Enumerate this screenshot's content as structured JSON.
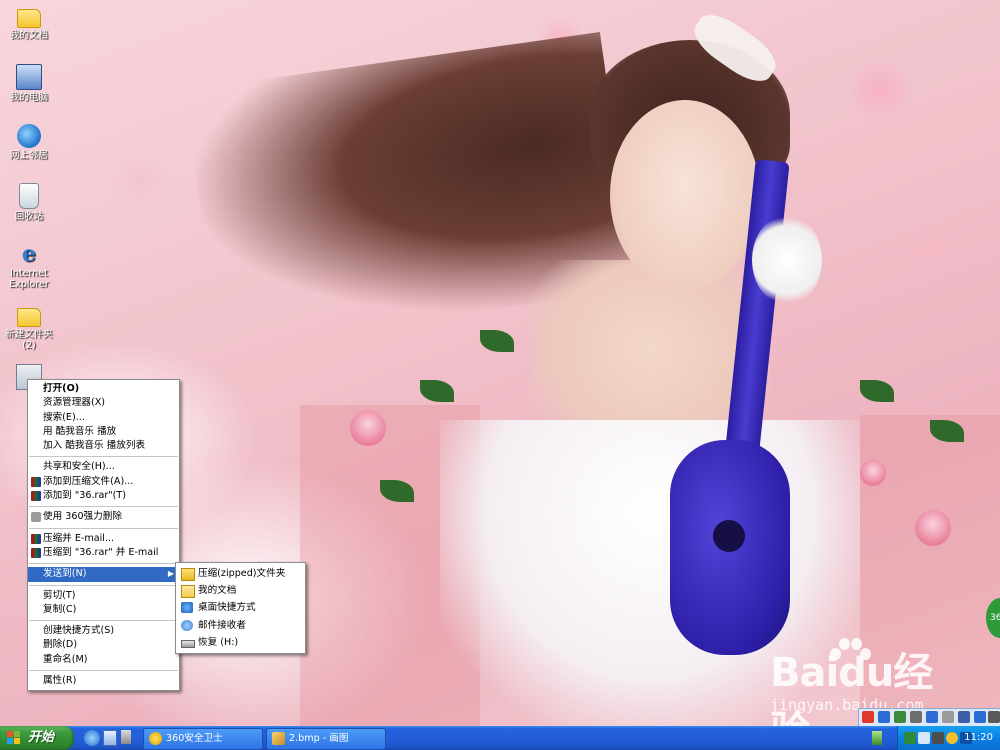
{
  "desktop_icons": [
    {
      "label": "我的文档",
      "icon": "my-documents-icon"
    },
    {
      "label": "我的电脑",
      "icon": "my-computer-icon"
    },
    {
      "label": "网上邻居",
      "icon": "network-places-icon"
    },
    {
      "label": "回收站",
      "icon": "recycle-bin-icon"
    },
    {
      "label": "Internet Explorer",
      "icon": "internet-explorer-icon"
    },
    {
      "label": "新建文件夹 (2)",
      "icon": "folder-icon"
    },
    {
      "label": "",
      "icon": "file-icon"
    }
  ],
  "context_menu": {
    "items": [
      {
        "label": "打开(O)",
        "bold": true
      },
      {
        "label": "资源管理器(X)"
      },
      {
        "label": "搜索(E)..."
      },
      {
        "label": "用 酷我音乐 播放"
      },
      {
        "label": "加入 酷我音乐 播放列表"
      },
      {
        "label": "共享和安全(H)..."
      },
      {
        "label": "添加到压缩文件(A)...",
        "icon": "winrar-icon"
      },
      {
        "label": "添加到 \"36.rar\"(T)",
        "icon": "winrar-icon"
      },
      {
        "label": "使用 360强力删除",
        "icon": "360-delete-icon"
      },
      {
        "label": "压缩并 E-mail...",
        "icon": "winrar-icon"
      },
      {
        "label": "压缩到 \"36.rar\" 并 E-mail",
        "icon": "winrar-icon"
      },
      {
        "label": "发送到(N)",
        "highlighted": true,
        "submenu": true
      },
      {
        "label": "剪切(T)"
      },
      {
        "label": "复制(C)"
      },
      {
        "label": "创建快捷方式(S)"
      },
      {
        "label": "删除(D)"
      },
      {
        "label": "重命名(M)"
      },
      {
        "label": "属性(R)"
      }
    ]
  },
  "send_to_menu": {
    "items": [
      {
        "label": "压缩(zipped)文件夹",
        "icon": "zip-folder-icon"
      },
      {
        "label": "我的文档",
        "icon": "my-documents-icon"
      },
      {
        "label": "桌面快捷方式",
        "icon": "desktop-shortcut-icon"
      },
      {
        "label": "邮件接收者",
        "icon": "mail-recipient-icon"
      },
      {
        "label": "恢复 (H:)",
        "icon": "drive-icon"
      }
    ]
  },
  "taskbar": {
    "start_label": "开始",
    "tasks": [
      {
        "label": "360安全卫士",
        "icon": "360-safe-icon"
      },
      {
        "label": "2.bmp - 画图",
        "icon": "paint-icon"
      }
    ],
    "clock": "11:20"
  },
  "watermark": {
    "brand": "Baidu经验",
    "site": "jingyan.baidu.com"
  },
  "colors": {
    "taskbar_blue": "#245edb",
    "start_green": "#3c9a3c",
    "menu_highlight": "#316ac5"
  }
}
